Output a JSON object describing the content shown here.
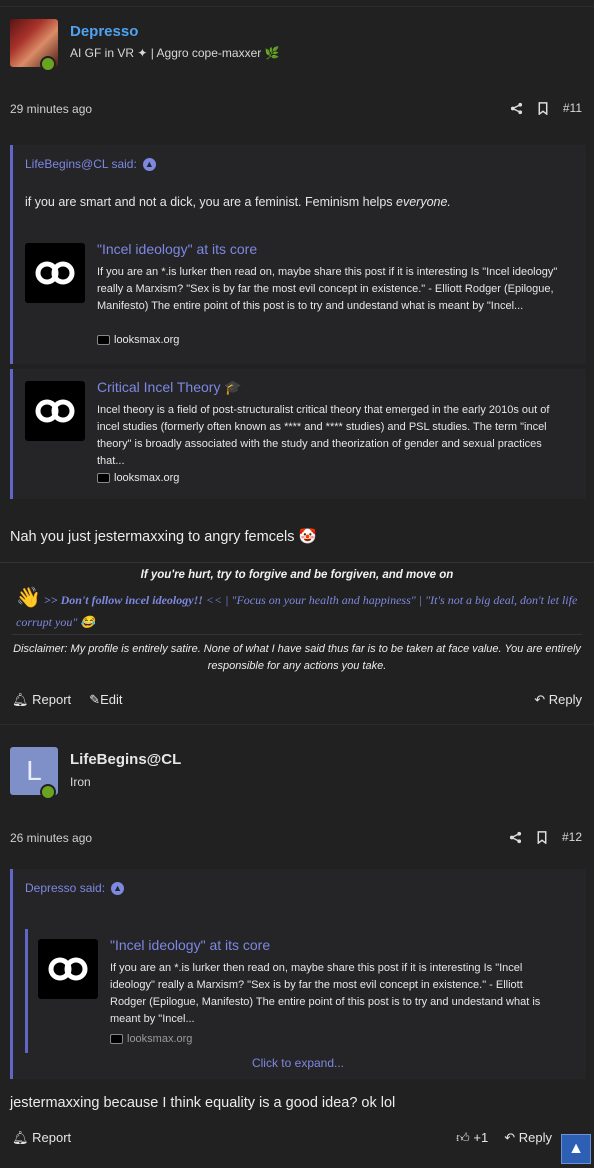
{
  "post1": {
    "username": "Depresso",
    "user_title": "AI GF in VR ✦ | Aggro cope-maxxer 🌿",
    "date": "29 minutes ago",
    "post_number": "#11",
    "quote": {
      "author": "LifeBegins@CL said:",
      "text_plain": "if you are smart and not a dick, you are a feminist. Feminism helps ",
      "text_em": "everyone."
    },
    "embeds": [
      {
        "title": "\"Incel ideology\" at its core",
        "body": "If you are an *.is lurker then read on, maybe share this post if it is interesting Is \"Incel ideology\" really a Marxism? \"Sex is by far the most evil concept in existence.\" - Elliott Rodger (Epilogue, Manifesto) The entire point of this post is to try and undestand what is meant by \"Incel...",
        "site": "looksmax.org"
      },
      {
        "title": "Critical Incel Theory 🎓",
        "body": "Incel theory is a field of post-structuralist critical theory that emerged in the early 2010s out of incel studies (formerly often known as **** and **** studies) and PSL studies. The term \"incel theory\" is broadly associated with the study and theorization of gender and sexual practices that...",
        "site": "looksmax.org"
      }
    ],
    "message": "Nah you just jestermaxxing to angry femcels 🤡",
    "signature": {
      "line1": "If you're hurt, try to forgive and be forgiven, and move on",
      "wave": "👋",
      "line2_bold": ">> Don't follow incel ideology!! ",
      "line2_rest": "<< | \"Focus on your health and happiness\" | \"It's not a big deal, don't let life corrupt you\" 😂"
    },
    "disclaimer": "Disclaimer: My profile is entirely satire. None of what I have said thus far is to be taken at face value. You are entirely responsible for any actions you take.",
    "footer": {
      "report": "Report",
      "edit": "Edit",
      "reply": "Reply"
    }
  },
  "post2": {
    "avatar_letter": "L",
    "username": "LifeBegins@CL",
    "user_title": "Iron",
    "date": "26 minutes ago",
    "post_number": "#12",
    "quote": {
      "author": "Depresso said:",
      "embed": {
        "title": "\"Incel ideology\" at its core",
        "body": "If you are an *.is lurker then read on, maybe share this post if it is interesting Is \"Incel ideology\" really a Marxism? \"Sex is by far the most evil concept in existence.\" - Elliott Rodger (Epilogue, Manifesto) The entire point of this post is to try and undestand what is meant by \"Incel...",
        "site": "looksmax.org"
      },
      "expand": "Click to expand..."
    },
    "message": "jestermaxxing because I think equality is a good idea? ok lol",
    "footer": {
      "report": "Report",
      "like_count": "+1",
      "reply": "Reply"
    }
  },
  "colors": {
    "accent": "#7d88e0",
    "link_blue": "#4ea3f0",
    "online": "#6aa31f",
    "background": "#212121"
  },
  "icons": [
    "share-icon",
    "bookmark-icon",
    "up-arrow-icon",
    "bell-icon",
    "edit-icon",
    "reply-icon",
    "thumbs-up-icon",
    "chevron-up-icon"
  ]
}
